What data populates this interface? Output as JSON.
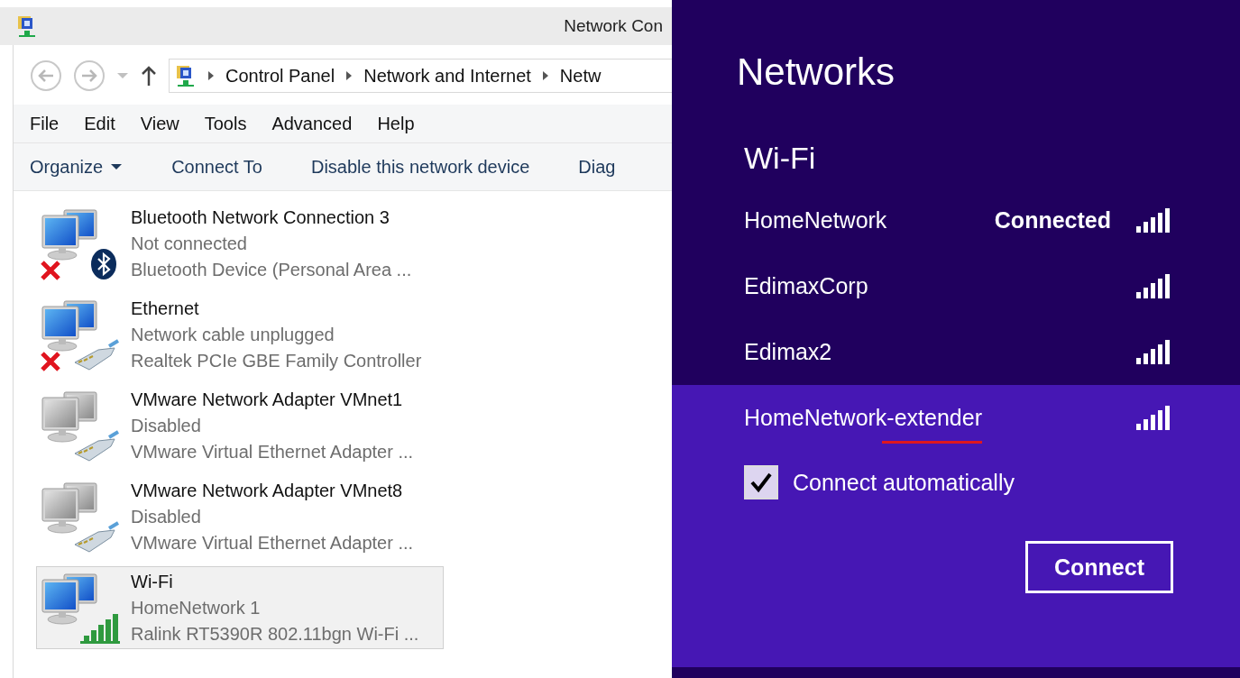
{
  "window": {
    "title": "Network Con"
  },
  "address_bar": {
    "path": [
      "Control Panel",
      "Network and Internet",
      "Netw"
    ]
  },
  "menu": [
    "File",
    "Edit",
    "View",
    "Tools",
    "Advanced",
    "Help"
  ],
  "toolbar": [
    {
      "label": "Organize",
      "dropdown": true
    },
    {
      "label": "Connect To",
      "dropdown": false
    },
    {
      "label": "Disable this network device",
      "dropdown": false
    },
    {
      "label": "Diag",
      "dropdown": false
    }
  ],
  "adapters": [
    {
      "name": "Bluetooth Network Connection 3",
      "status": "Not connected",
      "device": "Bluetooth Device (Personal Area ...",
      "kind": "bluetooth",
      "disabled": false,
      "error": true,
      "selected": false
    },
    {
      "name": "Ethernet",
      "status": "Network cable unplugged",
      "device": "Realtek PCIe GBE Family Controller",
      "kind": "ethernet",
      "disabled": false,
      "error": true,
      "selected": false
    },
    {
      "name": "VMware Network Adapter VMnet1",
      "status": "Disabled",
      "device": "VMware Virtual Ethernet Adapter ...",
      "kind": "ethernet",
      "disabled": true,
      "error": false,
      "selected": false
    },
    {
      "name": "VMware Network Adapter VMnet8",
      "status": "Disabled",
      "device": "VMware Virtual Ethernet Adapter ...",
      "kind": "ethernet",
      "disabled": true,
      "error": false,
      "selected": false
    },
    {
      "name": "Wi-Fi",
      "status": "HomeNetwork 1",
      "device": "Ralink RT5390R 802.11bgn Wi-Fi ...",
      "kind": "wifi",
      "disabled": false,
      "error": false,
      "selected": true
    }
  ],
  "networks_panel": {
    "title": "Networks",
    "section": "Wi-Fi",
    "networks": [
      {
        "name": "HomeNetwork",
        "status": "Connected",
        "selected": false,
        "underlined": false
      },
      {
        "name": "EdimaxCorp",
        "selected": false,
        "underlined": false
      },
      {
        "name": "Edimax2",
        "selected": false,
        "underlined": false
      },
      {
        "name": "HomeNetwork-extender",
        "selected": true,
        "underlined": true
      }
    ],
    "connect_automatically": {
      "label": "Connect automatically",
      "checked": true
    },
    "connect_button": "Connect"
  }
}
